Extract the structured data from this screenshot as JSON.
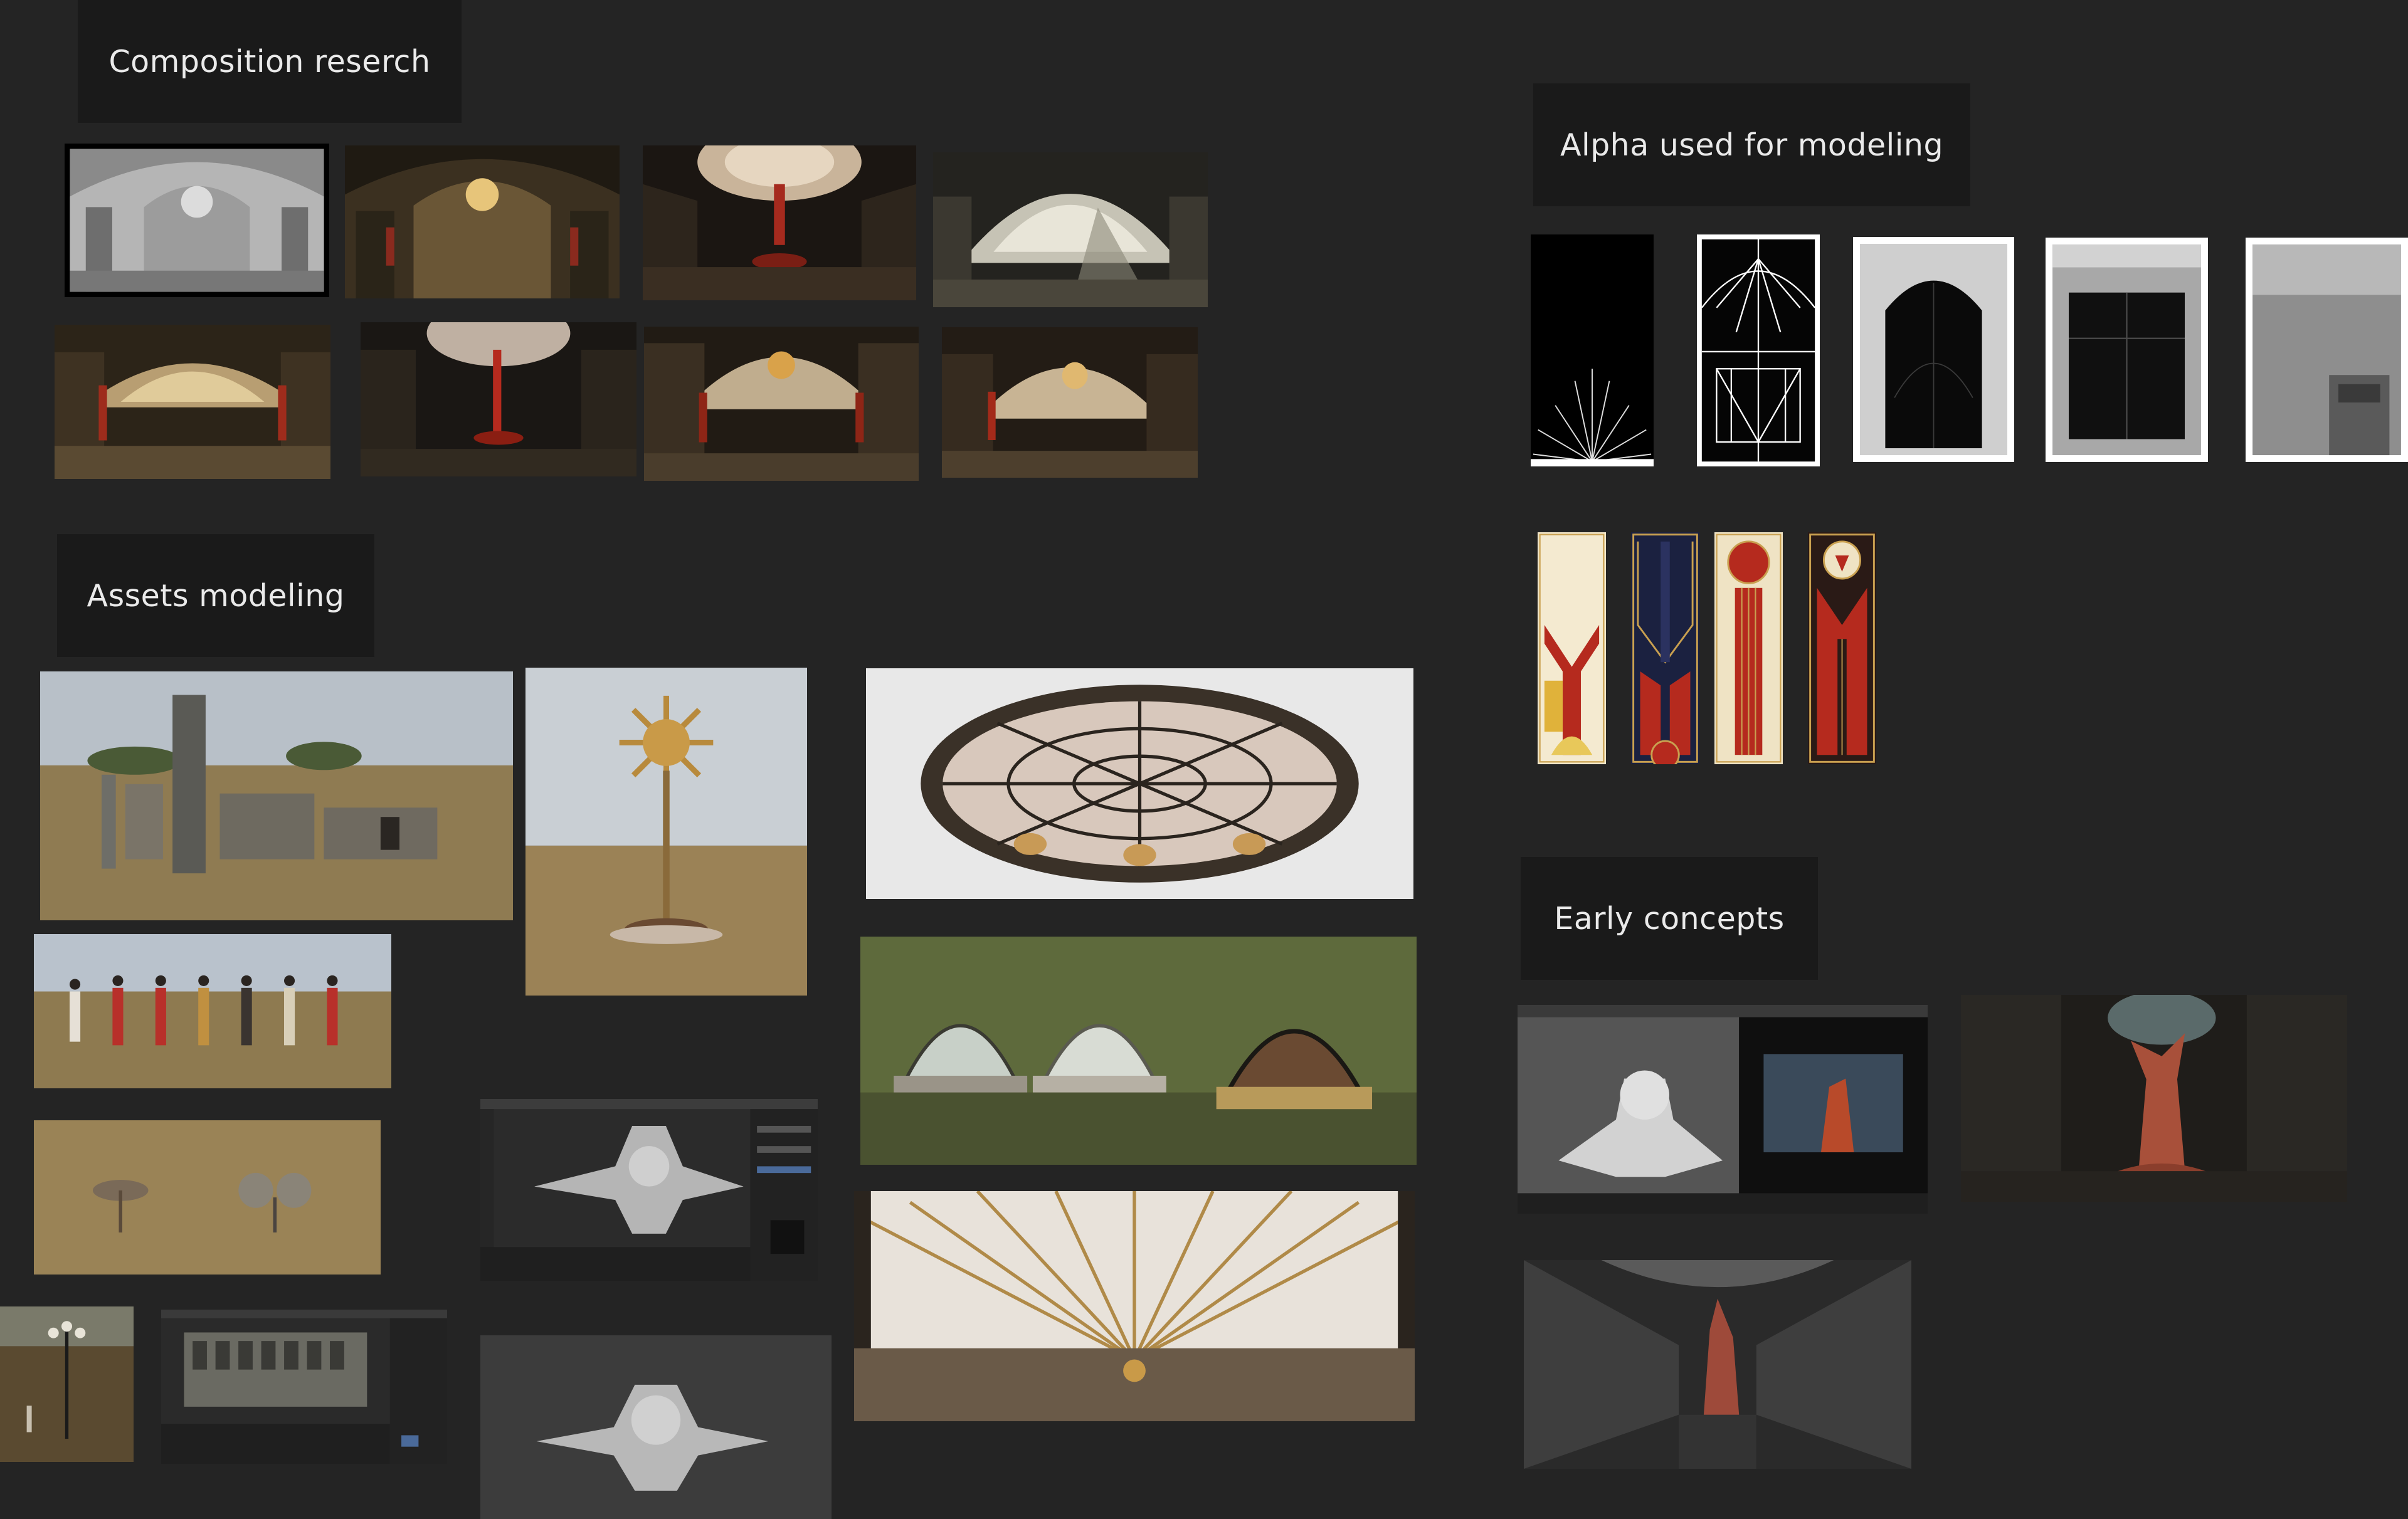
{
  "sections": {
    "composition": {
      "title": "Composition reserch"
    },
    "alpha": {
      "title": "Alpha used for modeling"
    },
    "assets": {
      "title": "Assets modeling"
    },
    "concepts": {
      "title": "Early concepts"
    }
  },
  "colors": {
    "background": "#242424",
    "label_bg": "#1a1a1a",
    "label_text": "#eaeaea",
    "gold": "#c9a050",
    "banner_red": "#b52a1e",
    "banner_navy": "#1b2140"
  }
}
